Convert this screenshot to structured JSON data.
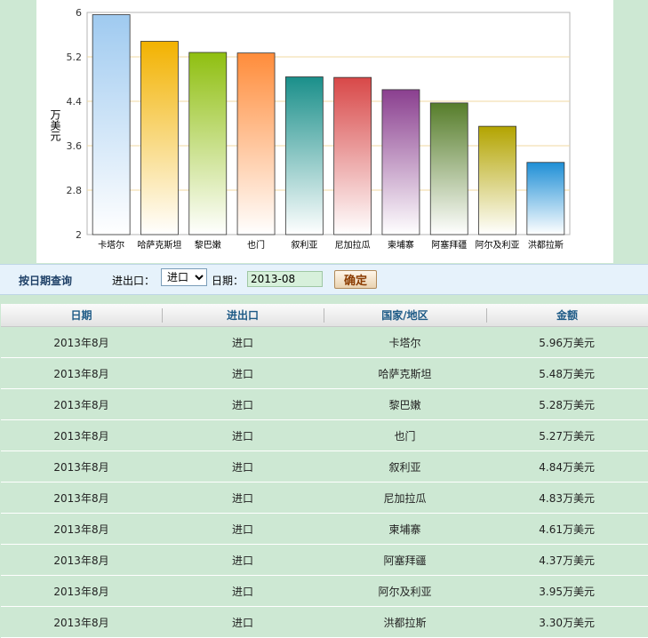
{
  "chart_data": {
    "type": "bar",
    "ylabel": "万美元",
    "ylim": [
      2,
      6
    ],
    "yticks": [
      "2",
      "2.8",
      "3.6",
      "4.4",
      "5.2",
      "6"
    ],
    "categories": [
      "卡塔尔",
      "哈萨克斯坦",
      "黎巴嫩",
      "也门",
      "叙利亚",
      "尼加拉瓜",
      "柬埔寨",
      "阿塞拜疆",
      "阿尔及利亚",
      "洪都拉斯"
    ],
    "values": [
      5.96,
      5.48,
      5.28,
      5.27,
      4.84,
      4.83,
      4.61,
      4.37,
      3.95,
      3.3
    ],
    "colors": [
      "#9fcaf0",
      "#f2b200",
      "#8fbf10",
      "#ff8c3a",
      "#1a8f8a",
      "#d84848",
      "#8a3f8f",
      "#567d2a",
      "#b3a400",
      "#1f8fd6"
    ],
    "grid": "horizontal"
  },
  "query": {
    "title": "按日期查询",
    "io_label": "进出口：",
    "io_selected": "进口",
    "date_label": "日期：",
    "date_value": "2013-08",
    "confirm_label": "确定"
  },
  "table": {
    "headers": [
      "日期",
      "进出口",
      "国家/地区",
      "金额"
    ],
    "rows": [
      [
        "2013年8月",
        "进口",
        "卡塔尔",
        "5.96万美元"
      ],
      [
        "2013年8月",
        "进口",
        "哈萨克斯坦",
        "5.48万美元"
      ],
      [
        "2013年8月",
        "进口",
        "黎巴嫩",
        "5.28万美元"
      ],
      [
        "2013年8月",
        "进口",
        "也门",
        "5.27万美元"
      ],
      [
        "2013年8月",
        "进口",
        "叙利亚",
        "4.84万美元"
      ],
      [
        "2013年8月",
        "进口",
        "尼加拉瓜",
        "4.83万美元"
      ],
      [
        "2013年8月",
        "进口",
        "柬埔寨",
        "4.61万美元"
      ],
      [
        "2013年8月",
        "进口",
        "阿塞拜疆",
        "4.37万美元"
      ],
      [
        "2013年8月",
        "进口",
        "阿尔及利亚",
        "3.95万美元"
      ],
      [
        "2013年8月",
        "进口",
        "洪都拉斯",
        "3.30万美元"
      ]
    ]
  }
}
